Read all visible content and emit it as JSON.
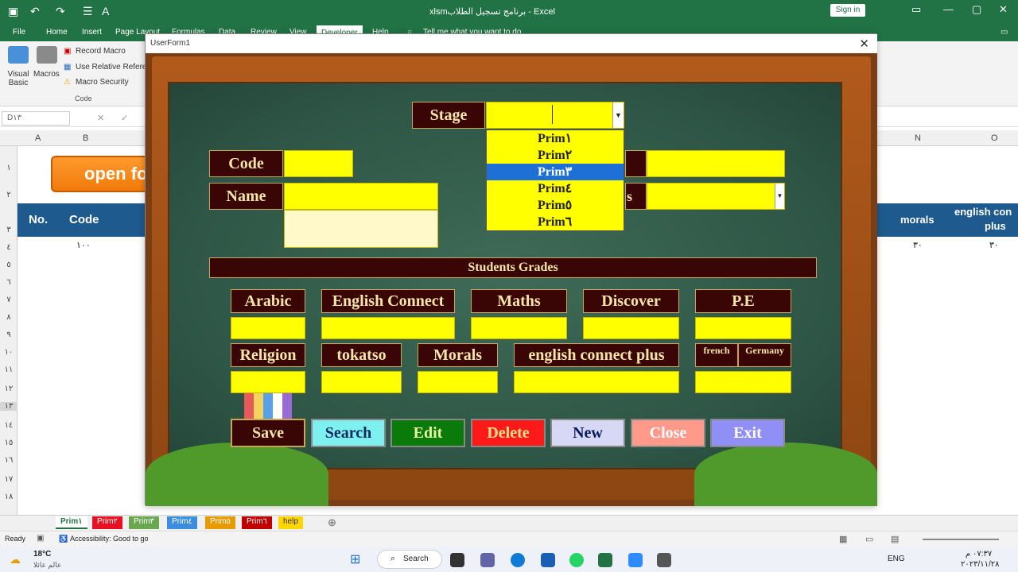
{
  "excel": {
    "title": "xlsmبرنامج تسجيل الطلاب - Excel",
    "sign_in": "Sign in",
    "menu": [
      "File",
      "Home",
      "Insert",
      "Page Layout",
      "Formulas",
      "Data",
      "Review",
      "View",
      "Developer",
      "Help"
    ],
    "tell_me": "Tell me what you want to do",
    "ribbon": {
      "visual_basic": "Visual Basic",
      "macros": "Macros",
      "record_macro": "Record Macro",
      "relative": "Use Relative Refere",
      "macro_security": "Macro Security",
      "group": "Code"
    },
    "name_box": "D١٣",
    "columns": [
      "A",
      "B",
      "N",
      "O"
    ],
    "rows": [
      "١",
      "٢",
      "٣",
      "٤",
      "٥",
      "٦",
      "٧",
      "٨",
      "٩",
      "١٠",
      "١١",
      "١٢",
      "١٣",
      "١٤",
      "١٥",
      "١٦",
      "١٧",
      "١٨"
    ],
    "open_button": "open fo",
    "header": {
      "no": "No.",
      "code": "Code",
      "morals": "morals",
      "english_line1": "english con",
      "english_line2": "plus"
    },
    "row4": {
      "code": "١٠٠",
      "morals": "٣٠",
      "english": "٣٠"
    },
    "sheet_tabs": [
      {
        "label": "Prim١",
        "color": "#ffffff"
      },
      {
        "label": "Prim٢",
        "color": "#e81123"
      },
      {
        "label": "Prim٣",
        "color": "#6aa84f"
      },
      {
        "label": "Prim٤",
        "color": "#3c8dde"
      },
      {
        "label": "Prim٥",
        "color": "#e69b00"
      },
      {
        "label": "Prim٦",
        "color": "#c00000"
      },
      {
        "label": "help",
        "color": "#ffd700"
      }
    ],
    "status_ready": "Ready",
    "accessibility": "Accessibility: Good to go"
  },
  "taskbar": {
    "weather_temp": "18°C",
    "weather_text": "عالم عائلا",
    "search": "Search",
    "lang": "ENG",
    "time": "٠٧:٣٧ م",
    "date": "٢٠٢٣/١١/٢٨"
  },
  "userform": {
    "title": "UserForm1",
    "stage_label": "Stage",
    "code_label": "Code",
    "name_label": "Name",
    "class_label_partial": "s",
    "students_grades": "Students Grades",
    "subjects_row1": [
      "Arabic",
      "English Connect",
      "Maths",
      "Discover",
      "P.E"
    ],
    "subjects_row2": [
      "Religion",
      "tokatso",
      "Morals",
      "english connect plus"
    ],
    "french": "french",
    "germany": "Germany",
    "stage_options": [
      "Prim١",
      "Prim٢",
      "Prim٣",
      "Prim٤",
      "Prim٥",
      "Prim٦"
    ],
    "stage_selected_index": 2,
    "buttons": {
      "save": "Save",
      "search": "Search",
      "edit": "Edit",
      "delete": "Delete",
      "new": "New",
      "close": "Close",
      "exit": "Exit"
    }
  },
  "colors": {
    "excel_green": "#217346",
    "header_blue": "#1e5a8e",
    "label_bg": "#3a0505",
    "field_yellow": "#ffff00",
    "board_green": "#2e5545"
  }
}
